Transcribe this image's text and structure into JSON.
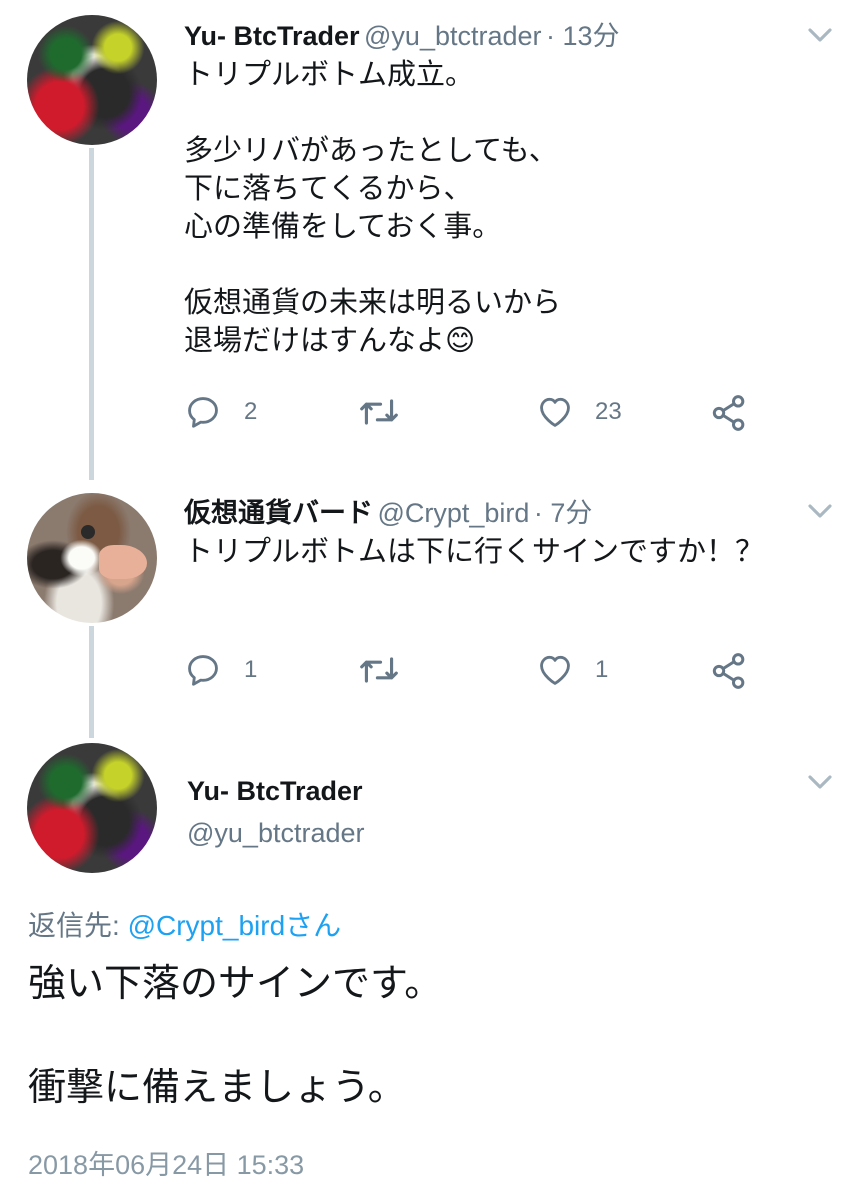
{
  "tweets": [
    {
      "display_name": "Yu- BtcTrader",
      "handle": "@yu_btctrader",
      "time": "· 13分",
      "text": "トリプルボトム成立。\n\n多少リバがあったとしても、\n下に落ちてくるから、\n心の準備をしておく事。\n\n仮想通貨の未来は明るいから\n退場だけはすんなよ😊",
      "reply_count": "2",
      "retweet_count": "",
      "like_count": "23"
    },
    {
      "display_name": "仮想通貨バード",
      "handle": "@Crypt_bird",
      "time": "· 7分",
      "text": "トリプルボトムは下に行くサインですか！？",
      "reply_count": "1",
      "retweet_count": "",
      "like_count": "1"
    }
  ],
  "main_tweet": {
    "display_name": "Yu- BtcTrader",
    "handle": "@yu_btctrader",
    "reply_to_label": "返信先: ",
    "reply_to_user": "@Crypt_birdさん",
    "text": "強い下落のサインです。\n\n衝撃に備えましょう。",
    "timestamp": "2018年06月24日 15:33"
  },
  "colors": {
    "accent": "#1da1f2",
    "icon_gray": "#657786",
    "thread_line": "#ccd6dd",
    "timestamp": "#8899a6"
  },
  "icons": [
    "chevron-down-icon",
    "reply-icon",
    "retweet-icon",
    "like-icon",
    "share-icon"
  ]
}
